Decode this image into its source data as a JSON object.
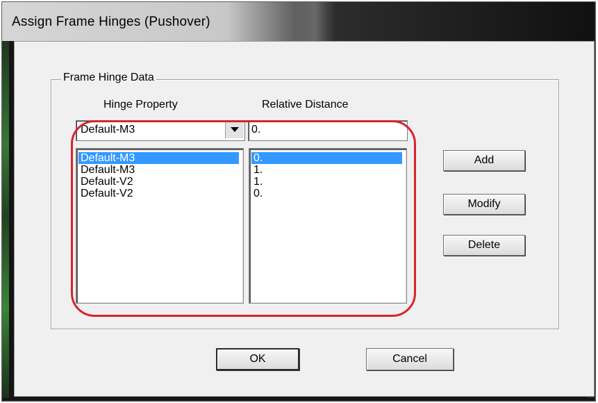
{
  "window": {
    "title": "Assign Frame Hinges (Pushover)"
  },
  "group": {
    "label": "Frame Hinge Data"
  },
  "columns": {
    "hinge_property": "Hinge Property",
    "relative_distance": "Relative Distance"
  },
  "inputs": {
    "hinge_property_selected": "Default-M3",
    "relative_distance_value": "0."
  },
  "rows": [
    {
      "hinge": "Default-M3",
      "distance": "0.",
      "selected": true
    },
    {
      "hinge": "Default-M3",
      "distance": "1.",
      "selected": false
    },
    {
      "hinge": "Default-V2",
      "distance": "1.",
      "selected": false
    },
    {
      "hinge": "Default-V2",
      "distance": "0.",
      "selected": false
    }
  ],
  "buttons": {
    "add": "Add",
    "modify": "Modify",
    "delete": "Delete",
    "ok": "OK",
    "cancel": "Cancel"
  },
  "colors": {
    "selection": "#3399ff",
    "annotation": "#d9232a"
  },
  "icons": {
    "dropdown": "chevron-down-icon"
  }
}
